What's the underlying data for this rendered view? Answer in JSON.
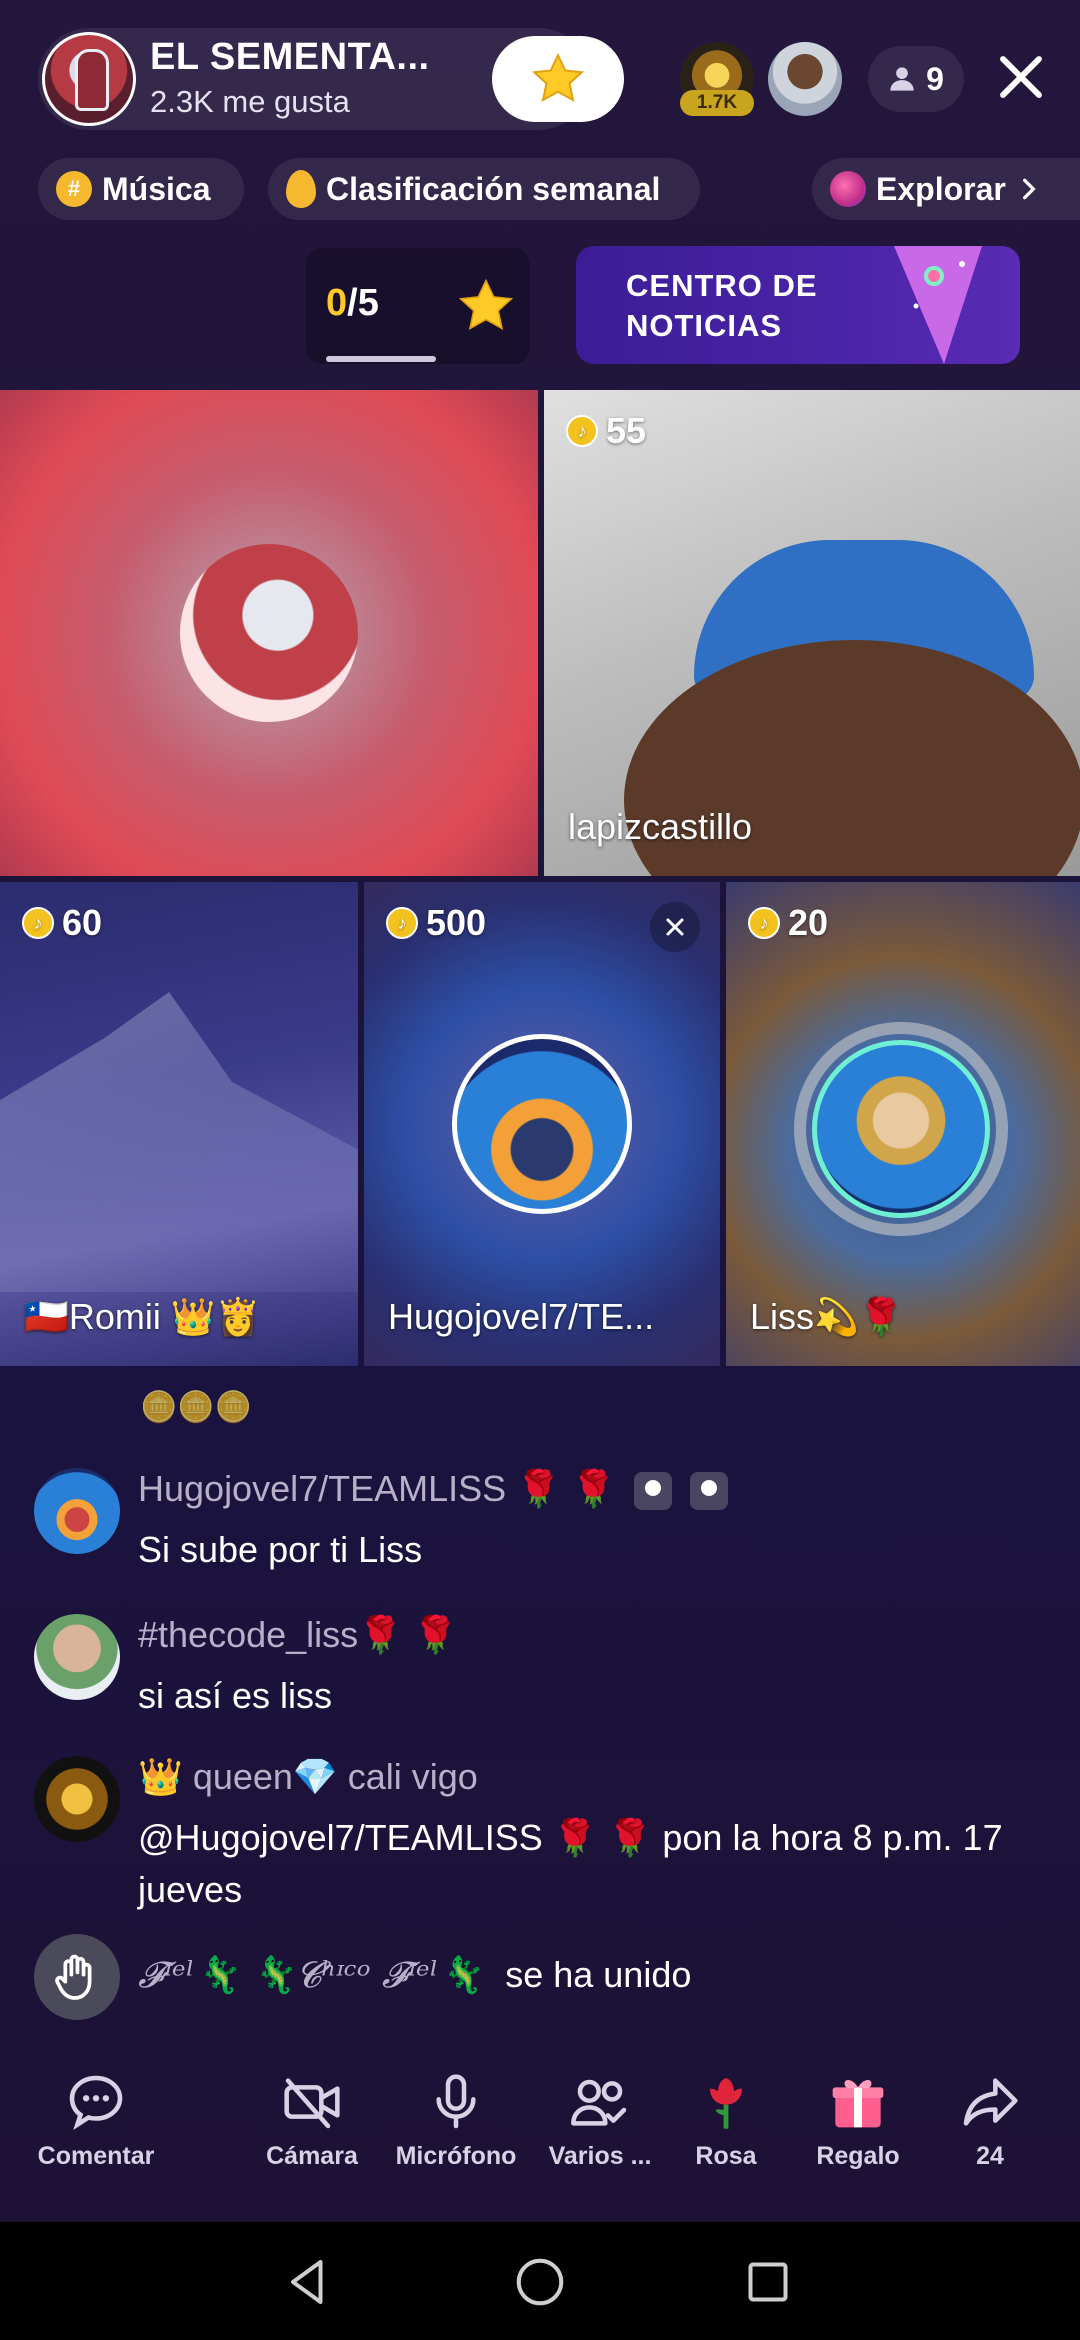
{
  "header": {
    "host_name": "EL SEMENTA...",
    "host_likes": "2.3K me gusta",
    "top_badge": "1.7K",
    "viewer_count": "9"
  },
  "chips": [
    {
      "label": "Música",
      "icon": "hashtag-icon",
      "color": "#f5b82e"
    },
    {
      "label": "Clasificación semanal",
      "icon": "flame-icon",
      "color": "#f5b82e"
    },
    {
      "label": "Explorar",
      "icon": "planet-icon",
      "color": "#e0408a"
    }
  ],
  "goal": {
    "current": "0",
    "total": "/5",
    "accent": "#ffc928"
  },
  "news_banner": {
    "line1": "CENTRO DE",
    "line2": "NOTICIAS"
  },
  "tiles": [
    {
      "coins": "",
      "name": ""
    },
    {
      "coins": "55",
      "name": "lapizcastillo"
    },
    {
      "coins": "60",
      "name": "🇨🇱Romii 👑👸"
    },
    {
      "coins": "500",
      "name": "Hugojovel7/TE..."
    },
    {
      "coins": "20",
      "name": "Liss💫🌹"
    }
  ],
  "chat": {
    "fade_text": "🪙🪙🪙",
    "messages": [
      {
        "name": "Hugojovel7/TEAMLISS 🌹 🌹",
        "text": "Si sube por ti Liss"
      },
      {
        "name": "#thecode_liss🌹 🌹",
        "text": "si así es liss"
      },
      {
        "name": "👑 queen💎 cali vigo",
        "text": "@Hugojovel7/TEAMLISS 🌹 🌹 pon la hora 8 p.m. 17 jueves"
      }
    ],
    "joined": {
      "name": "𝓕ᶦᵉˡ🦎 🦎𝓒ʰᶦᶜᵒ 𝓕ᶦᵉˡ🦎",
      "action": "se ha unido"
    }
  },
  "actions": [
    {
      "label": "Comentar",
      "icon": "comment-icon"
    },
    {
      "label": "Cámara",
      "icon": "camera-off-icon"
    },
    {
      "label": "Micrófono",
      "icon": "microphone-icon"
    },
    {
      "label": "Varios ...",
      "icon": "multi-guest-icon"
    },
    {
      "label": "Rosa",
      "icon": "rose-icon"
    },
    {
      "label": "Regalo",
      "icon": "gift-icon"
    },
    {
      "label": "24",
      "icon": "share-icon"
    }
  ],
  "colors": {
    "gold": "#f4c21e",
    "news_bg": "#3b1d96",
    "bg": "#1e1438"
  }
}
